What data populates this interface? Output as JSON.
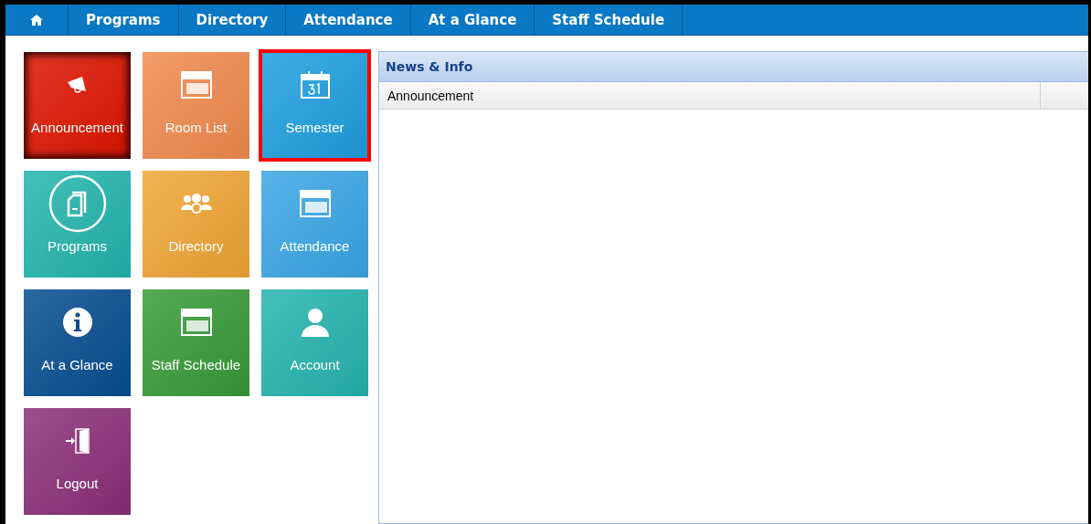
{
  "nav": {
    "items": [
      {
        "label": "Programs"
      },
      {
        "label": "Directory"
      },
      {
        "label": "Attendance"
      },
      {
        "label": "At a Glance"
      },
      {
        "label": "Staff Schedule"
      }
    ]
  },
  "tiles": [
    {
      "label": "Announcement",
      "color": "#e01400",
      "selected": true,
      "highlighted": false
    },
    {
      "label": "Room List",
      "color": "#f28a4e",
      "selected": false,
      "highlighted": false
    },
    {
      "label": "Semester",
      "color": "#1e9fe0",
      "selected": false,
      "highlighted": true
    },
    {
      "label": "Programs",
      "color": "#22b5ad",
      "selected": false,
      "highlighted": false
    },
    {
      "label": "Directory",
      "color": "#f0a535",
      "selected": false,
      "highlighted": false
    },
    {
      "label": "Attendance",
      "color": "#3aa6e6",
      "selected": false,
      "highlighted": false
    },
    {
      "label": "At a Glance",
      "color": "#064d91",
      "selected": false,
      "highlighted": false
    },
    {
      "label": "Staff Schedule",
      "color": "#379b38",
      "selected": false,
      "highlighted": false
    },
    {
      "label": "Account",
      "color": "#25b4ae",
      "selected": false,
      "highlighted": false
    },
    {
      "label": "Logout",
      "color": "#8a2f78",
      "selected": false,
      "highlighted": false
    }
  ],
  "news": {
    "title": "News & Info",
    "columns": [
      "Announcement"
    ]
  }
}
